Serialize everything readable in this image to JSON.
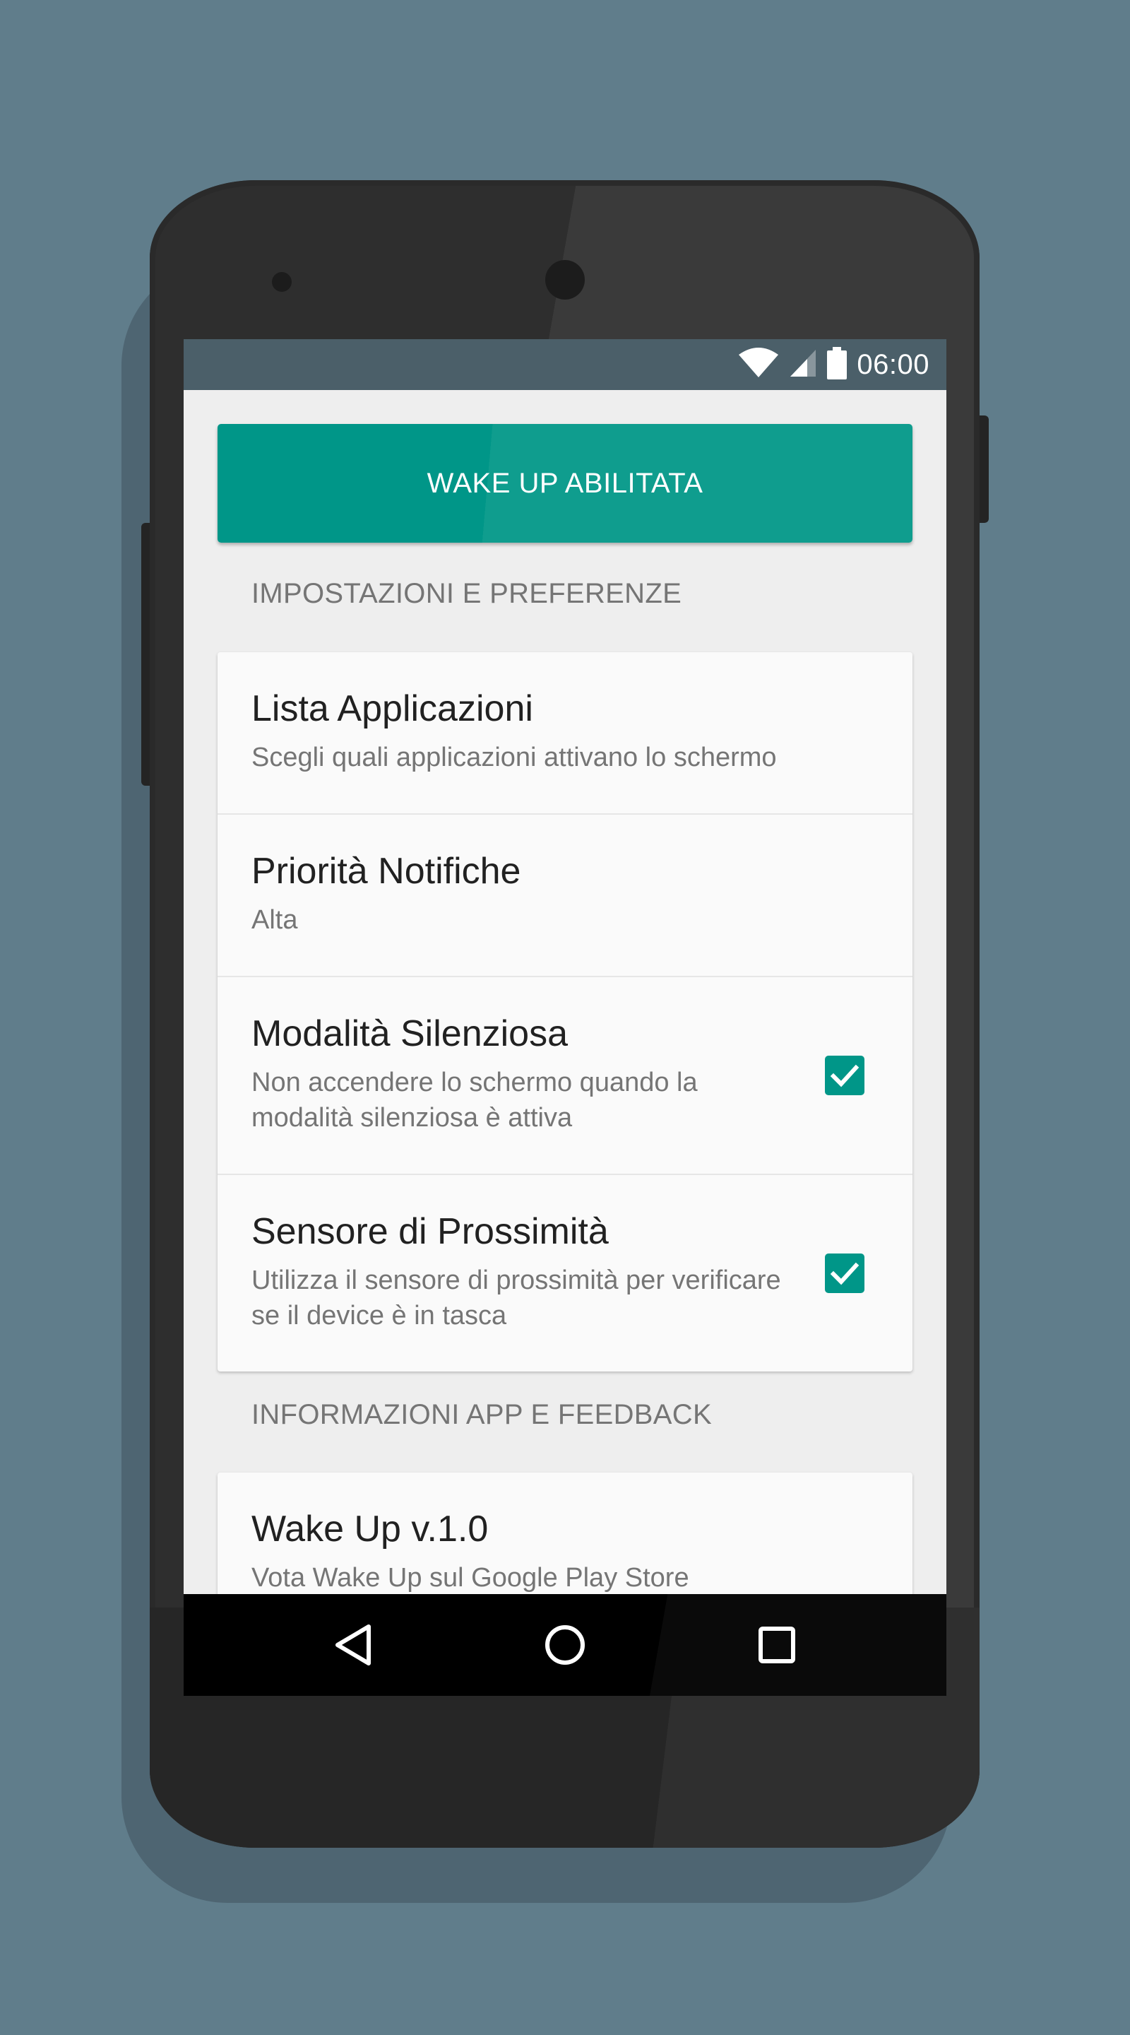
{
  "status_bar": {
    "time": "06:00",
    "icons": [
      "wifi-icon",
      "cell-signal-icon",
      "battery-icon"
    ]
  },
  "main": {
    "enable_button_label": "WAKE UP ABILITATA",
    "sections": [
      {
        "header": "IMPOSTAZIONI E PREFERENZE",
        "items": [
          {
            "title": "Lista Applicazioni",
            "summary": "Scegli quali applicazioni attivano lo schermo"
          },
          {
            "title": "Priorità Notifiche",
            "summary": "Alta"
          },
          {
            "title": "Modalità Silenziosa",
            "summary": "Non accendere lo schermo quando la modalità silenziosa è attiva",
            "checked": true
          },
          {
            "title": "Sensore di Prossimità",
            "summary": "Utilizza il sensore di prossimità per verificare se il device è in tasca",
            "checked": true
          }
        ]
      },
      {
        "header": "INFORMAZIONI APP E FEEDBACK",
        "items": [
          {
            "title": "Wake Up v.1.0",
            "summary": "Vota Wake Up sul Google Play Store"
          }
        ]
      }
    ]
  },
  "nav_bar": {
    "icons": [
      "back-icon",
      "home-icon",
      "recents-icon"
    ]
  },
  "colors": {
    "background": "#607d8b",
    "accent": "#009688",
    "status_bar": "#4b5f69",
    "screen_background": "#eeeeee",
    "card": "#fafafa"
  }
}
